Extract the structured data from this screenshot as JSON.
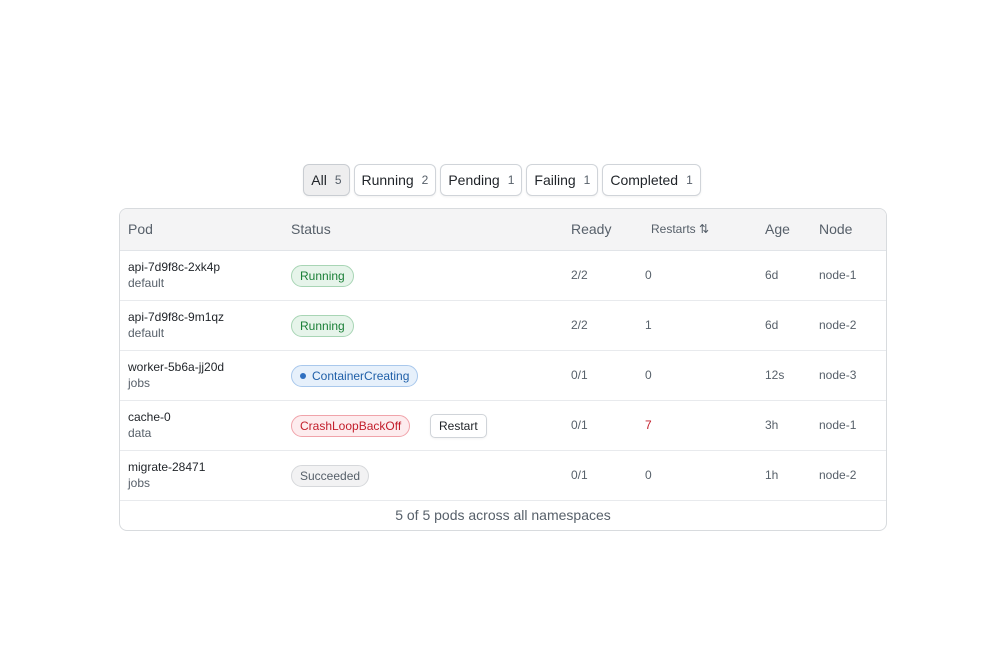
{
  "filters": [
    {
      "label": "All",
      "count": "5"
    },
    {
      "label": "Running",
      "count": "2"
    },
    {
      "label": "Pending",
      "count": "1"
    },
    {
      "label": "Failing",
      "count": "1"
    },
    {
      "label": "Completed",
      "count": "1"
    }
  ],
  "table": {
    "headers": {
      "pod": "Pod",
      "status": "Status",
      "ready": "Ready",
      "restarts": "Restarts",
      "sort_icon": "⇅",
      "age": "Age",
      "node": "Node"
    },
    "rows": [
      {
        "name": "api-7d9f8c-2xk4p",
        "namespace": "default",
        "status": "Running",
        "ready": "2/2",
        "restarts": "0",
        "age": "6d",
        "node": "node-1"
      },
      {
        "name": "api-7d9f8c-9m1qz",
        "namespace": "default",
        "status": "Running",
        "ready": "2/2",
        "restarts": "1",
        "age": "6d",
        "node": "node-2"
      },
      {
        "name": "worker-5b6a-jj20d",
        "namespace": "jobs",
        "status": "ContainerCreating",
        "ready": "0/1",
        "restarts": "0",
        "age": "12s",
        "node": "node-3"
      },
      {
        "name": "cache-0",
        "namespace": "data",
        "status": "CrashLoopBackOff",
        "action": "Restart",
        "ready": "0/1",
        "restarts": "7",
        "age": "3h",
        "node": "node-1"
      },
      {
        "name": "migrate-28471",
        "namespace": "jobs",
        "status": "Succeeded",
        "ready": "0/1",
        "restarts": "0",
        "age": "1h",
        "node": "node-2"
      }
    ],
    "footer": "5 of 5 pods across all namespaces"
  },
  "colors": {
    "running": "#1a7f37",
    "creating": "#1f5fa8",
    "crash": "#c21e2b",
    "succeeded": "#57606a"
  }
}
